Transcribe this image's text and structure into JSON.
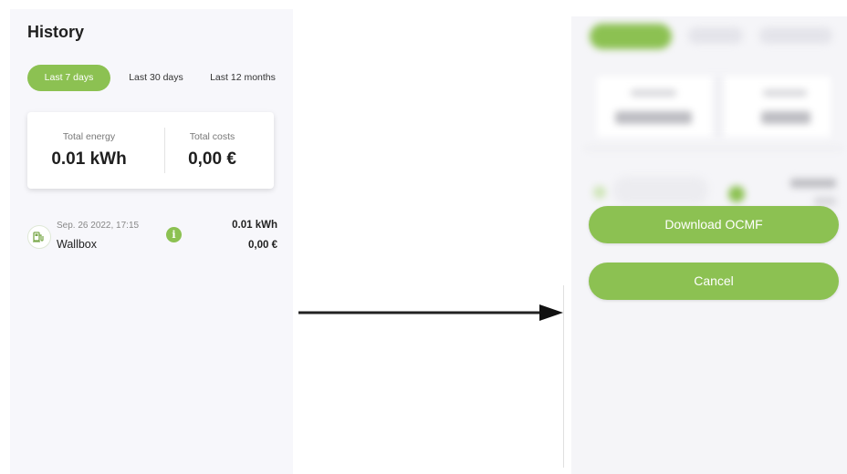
{
  "left_screen": {
    "title": "History",
    "tabs": [
      "Last 7 days",
      "Last 30 days",
      "Last 12 months"
    ],
    "summary": {
      "energy_label": "Total energy",
      "energy_value": "0.01 kWh",
      "cost_label": "Total costs",
      "cost_value": "0,00 €"
    },
    "item": {
      "date": "Sep. 26 2022, 17:15",
      "name": "Wallbox",
      "energy": "0.01 kWh",
      "cost": "0,00 €",
      "info_glyph": "i"
    }
  },
  "right_screen": {
    "download_label": "Download OCMF",
    "cancel_label": "Cancel"
  },
  "colors": {
    "accent": "#8cc152",
    "screen_bg": "#f7f7fb"
  },
  "icons": [
    "charging-station-icon",
    "info-icon",
    "arrow-right-icon"
  ]
}
